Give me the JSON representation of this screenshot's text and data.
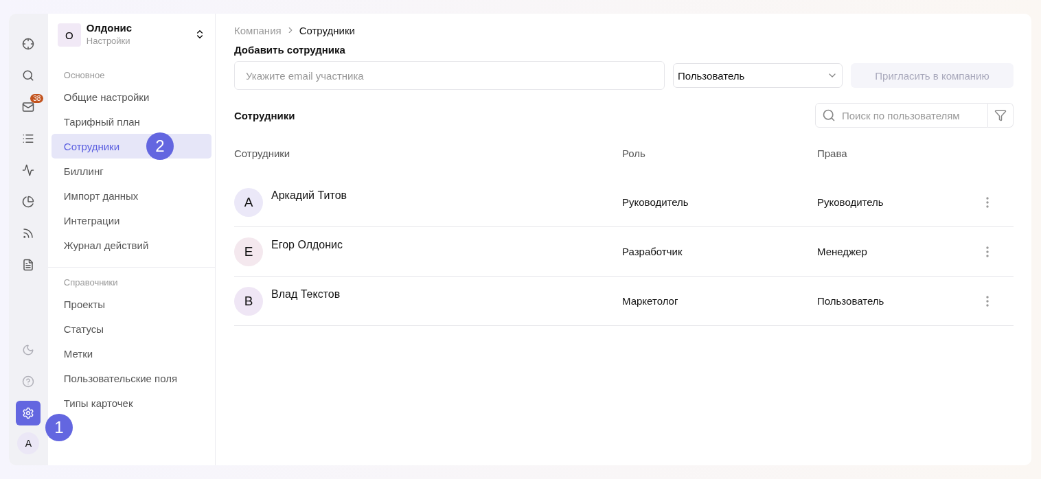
{
  "rail": {
    "top": [
      {
        "kind": "target",
        "selected": false
      },
      {
        "kind": "search",
        "selected": false
      },
      {
        "kind": "inbox",
        "selected": false,
        "badge": "38"
      },
      {
        "kind": "list",
        "selected": false
      },
      {
        "kind": "activity",
        "selected": false
      },
      {
        "kind": "pie",
        "selected": false
      },
      {
        "kind": "rss",
        "selected": false
      },
      {
        "kind": "file",
        "selected": false
      }
    ],
    "bottom": [
      {
        "kind": "moon",
        "selected": false
      },
      {
        "kind": "help",
        "selected": false
      },
      {
        "kind": "settings",
        "selected": true
      }
    ],
    "avatar": "A"
  },
  "workspace": {
    "initial": "О",
    "name": "Олдонис",
    "subtitle": "Настройки"
  },
  "sidebar": {
    "groups": [
      {
        "title": "Основное",
        "items": [
          {
            "label": "Общие настройки",
            "selected": false
          },
          {
            "label": "Тарифный план",
            "selected": false
          },
          {
            "label": "Сотрудники",
            "selected": true
          },
          {
            "label": "Биллинг",
            "selected": false
          },
          {
            "label": "Импорт данных",
            "selected": false
          },
          {
            "label": "Интеграции",
            "selected": false
          },
          {
            "label": "Журнал действий",
            "selected": false
          }
        ]
      },
      {
        "title": "Справочники",
        "items": [
          {
            "label": "Проекты",
            "selected": false
          },
          {
            "label": "Статусы",
            "selected": false
          },
          {
            "label": "Метки",
            "selected": false
          },
          {
            "label": "Пользовательские поля",
            "selected": false
          },
          {
            "label": "Типы карточек",
            "selected": false
          }
        ]
      }
    ]
  },
  "breadcrumb": [
    "Компания",
    "Сотрудники"
  ],
  "invite": {
    "title": "Добавить сотрудника",
    "placeholder": "Укажите email участника",
    "role": "Пользователь",
    "button": "Пригласить в компанию",
    "button_disabled": true
  },
  "members": {
    "title": "Сотрудники",
    "search_placeholder": "Поиск по пользователям",
    "columns": [
      "Сотрудники",
      "Роль",
      "Права"
    ],
    "rows": [
      {
        "initial": "А",
        "name": "Аркадий Титов",
        "role": "Руководитель",
        "rights": "Руководитель",
        "color": "#ebe8f8"
      },
      {
        "initial": "Е",
        "name": "Егор Олдонис",
        "role": "Разработчик",
        "rights": "Менеджер",
        "color": "#f4e8ee"
      },
      {
        "initial": "В",
        "name": "Влад Текстов",
        "role": "Маркетолог",
        "rights": "Пользователь",
        "color": "#efe6f5"
      }
    ]
  },
  "annotations": [
    {
      "label": "1"
    },
    {
      "label": "2"
    }
  ]
}
